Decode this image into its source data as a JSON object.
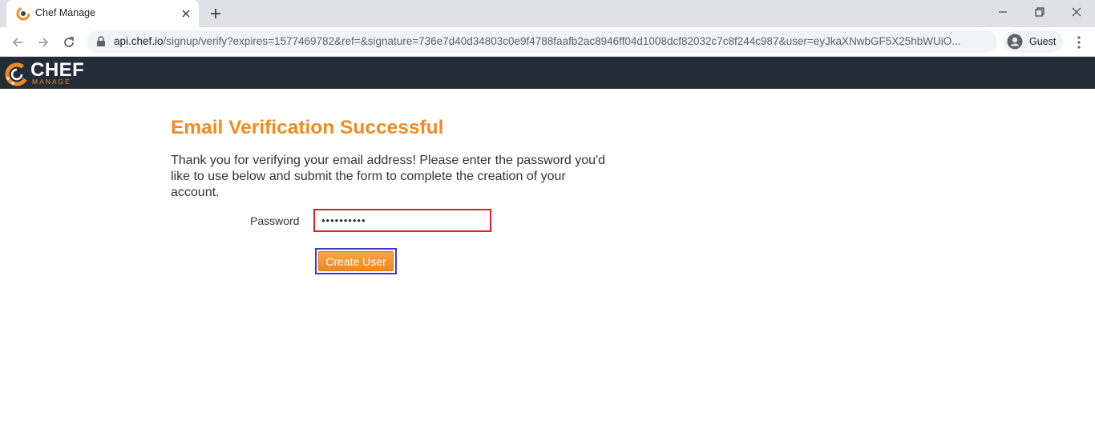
{
  "browser": {
    "tab_title": "Chef Manage",
    "url_host": "api.chef.io",
    "url_rest": "/signup/verify?expires=1577469782&ref=&signature=736e7d40d34803c0e9f4788faafb2ac8946ff04d1008dcf82032c7c8f244c987&user=eyJkaXNwbGF5X25hbWUiO...",
    "profile_label": "Guest"
  },
  "header": {
    "logo_text": "CHEF",
    "logo_subtext": "MANAGE",
    "accent_color": "#f18b21",
    "bar_color": "#232d37"
  },
  "page": {
    "title": "Email Verification Successful",
    "intro": "Thank you for verifying your email address! Please enter the password you'd like to use below and submit the form to complete the creation of your account.",
    "password_label": "Password",
    "password_value": "••••••••••",
    "submit_label": "Create User"
  }
}
